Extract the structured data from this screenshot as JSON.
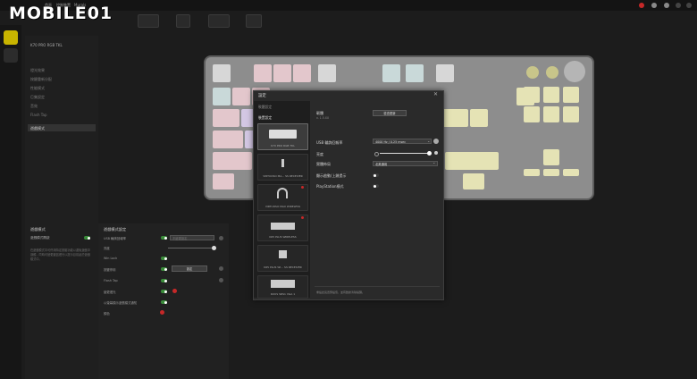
{
  "nav": {
    "home": "首頁",
    "device": "控制裝置",
    "murals": "Murals"
  },
  "watermark": "MOBILE01",
  "left_panel": {
    "device_name": "K70 PRO RGB TKL",
    "items": [
      "燈光效果",
      "按鍵重新分配",
      "性能模式",
      "巨集設定",
      "音效",
      "Flash Tap",
      "遊戲模式"
    ]
  },
  "keyboard_panel": {
    "title": "遊戲模式",
    "row1_label": "遊戲模式開啟",
    "desc": "在遊戲模式中可停用特定按鍵功能以避免遊戲中誤觸，同時可變更鍵盤燈光以提示目前處於遊戲模式中。"
  },
  "settings_panel": {
    "title": "遊戲模式設定",
    "rows": [
      {
        "label": "USB 輪詢回報率",
        "value": "不變更設定"
      },
      {
        "label": "亮度",
        "value": ""
      },
      {
        "label": "Win Lock",
        "value": ""
      },
      {
        "label": "按鍵停用",
        "value": "設定"
      },
      {
        "label": "Flash Tap",
        "value": ""
      },
      {
        "label": "變更燈光",
        "value": ""
      },
      {
        "label": "以螢幕顯示遊戲模式通知",
        "value": ""
      },
      {
        "label": "顏色",
        "value": ""
      }
    ]
  },
  "dialog": {
    "title": "設定",
    "tab_general": "軟體設定",
    "tab_device": "裝置設定",
    "devices": [
      {
        "name": "K70 PRO RGB TKL",
        "selected": true
      },
      {
        "name": "VIRTUOSO MA... SS RECEIVER",
        "selected": false
      },
      {
        "name": "VIRTUOSO MAX WIRELESS",
        "selected": false
      },
      {
        "name": "K65 PLUS WIRELESS",
        "selected": false
      },
      {
        "name": "K65 PLUS WI... SS RECEIVER",
        "selected": false
      },
      {
        "name": "KOUS SRS1 VGA 1",
        "selected": false
      }
    ],
    "firmware_label": "韌體",
    "firmware_version": "v. 1.5.XX",
    "firmware_button": "檢查更新",
    "polling_label": "USB 輪詢回報率",
    "polling_value": "4000 Hz / 0.25 msec",
    "brightness_label": "亮度",
    "layout_label": "實體佈局",
    "layout_value": "北美通用",
    "lock_label": "顯示啟動/上鎖提示",
    "ps_label": "PlayStation模式",
    "footer_note": "重設此裝置預設值，並有數據清除提醒。"
  },
  "colors": {
    "accent_green": "#3a8c3a",
    "alert_red": "#c62828",
    "rail_yellow": "#c8b400"
  }
}
